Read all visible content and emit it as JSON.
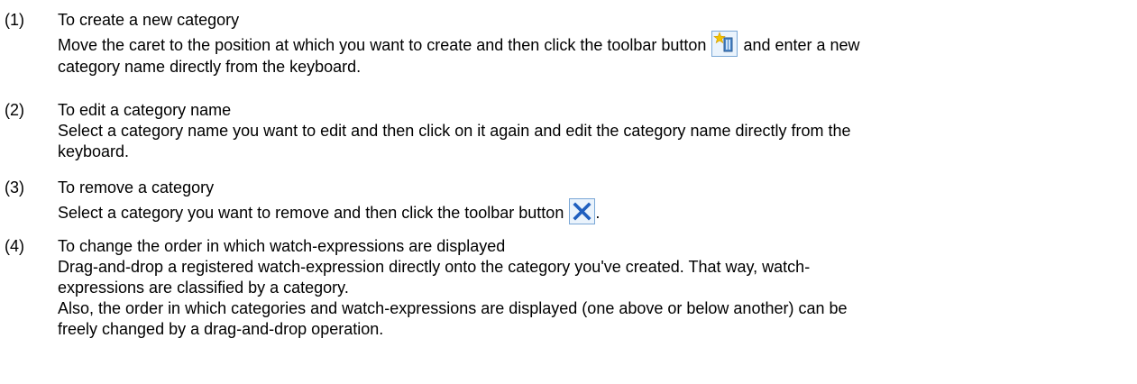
{
  "items": [
    {
      "number": "(1)",
      "title": "To create a new category",
      "body": {
        "before_icon": "Move the caret to the position at which you want to create and then click the toolbar button",
        "icon": "new-category-icon",
        "after_icon": "and enter a new",
        "line2": "category name directly from the keyboard."
      }
    },
    {
      "number": "(2)",
      "title": "To edit a category name",
      "lines": [
        "Select a category name you want to edit and then click on it again and edit the category name directly from the",
        "keyboard."
      ]
    },
    {
      "number": "(3)",
      "title": "To remove a category",
      "body": {
        "before_icon": "Select a category you want to remove and then click the toolbar button",
        "icon": "remove-icon",
        "after_icon": "."
      }
    },
    {
      "number": "(4)",
      "title": "To change the order in which watch-expressions are displayed",
      "lines": [
        "Drag-and-drop a registered watch-expression directly onto the category you've created. That way, watch-",
        "expressions are classified by a category.",
        "Also, the order in which categories and watch-expressions are displayed (one above or below another) can be",
        "freely changed by a drag-and-drop operation."
      ]
    }
  ],
  "colors": {
    "text": "#000000",
    "icon_border": "#7aa7d6",
    "icon_bg": "#eaf3fc",
    "remove_x": "#1f5fbf",
    "sparkle": "#f2c300"
  }
}
